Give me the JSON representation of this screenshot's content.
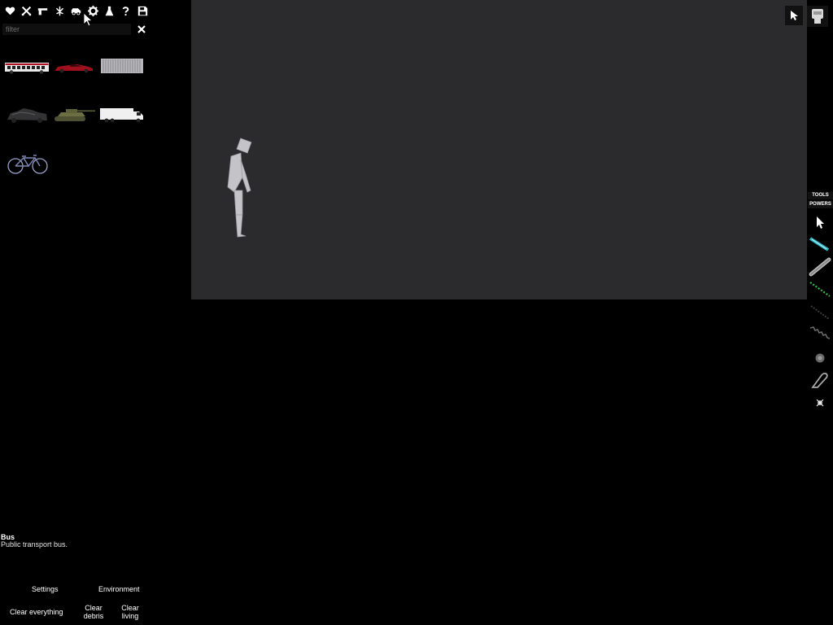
{
  "toolbar": {
    "categories": [
      {
        "name": "heart-icon"
      },
      {
        "name": "crossed-swords-icon"
      },
      {
        "name": "pistol-icon"
      },
      {
        "name": "plant-icon"
      },
      {
        "name": "car-icon"
      },
      {
        "name": "gear-icon"
      },
      {
        "name": "flask-icon"
      },
      {
        "name": "question-icon"
      },
      {
        "name": "save-icon"
      }
    ]
  },
  "filter": {
    "placeholder": "filter",
    "value": ""
  },
  "items": [
    {
      "name": "bus",
      "icon": "bus-thumbnail"
    },
    {
      "name": "car",
      "icon": "red-car-thumbnail"
    },
    {
      "name": "container",
      "icon": "shipping-container-thumbnail"
    },
    {
      "name": "wreck",
      "icon": "wreck-thumbnail"
    },
    {
      "name": "tank",
      "icon": "tank-thumbnail"
    },
    {
      "name": "truck",
      "icon": "truck-thumbnail"
    },
    {
      "name": "bicycle",
      "icon": "bicycle-thumbnail"
    }
  ],
  "info": {
    "title": "Bus",
    "description": "Public transport bus."
  },
  "menu": {
    "settings": "Settings",
    "environment": "Environment",
    "clear_everything": "Clear everything",
    "clear_debris": "Clear debris",
    "clear_living": "Clear living"
  },
  "tabs": {
    "tools": "TOOLS",
    "powers": "POWERS"
  },
  "tools": [
    {
      "name": "pointer-tool",
      "icon": "cursor-icon"
    },
    {
      "name": "laser-tool",
      "icon": "laser-icon"
    },
    {
      "name": "rod-tool",
      "icon": "rod-icon"
    },
    {
      "name": "wire-tool",
      "icon": "green-wire-icon"
    },
    {
      "name": "rope-tool",
      "icon": "rope-icon"
    },
    {
      "name": "spring-tool",
      "icon": "spring-icon"
    },
    {
      "name": "hinge-tool",
      "icon": "hinge-icon"
    },
    {
      "name": "loop-tool",
      "icon": "loop-icon"
    },
    {
      "name": "pin-tool",
      "icon": "pin-icon"
    }
  ],
  "colors": {
    "viewport": "#2b2b2e",
    "sidebar": "#000000",
    "accent_green": "#2fbf4a",
    "accent_cyan": "#2fb8c8"
  }
}
